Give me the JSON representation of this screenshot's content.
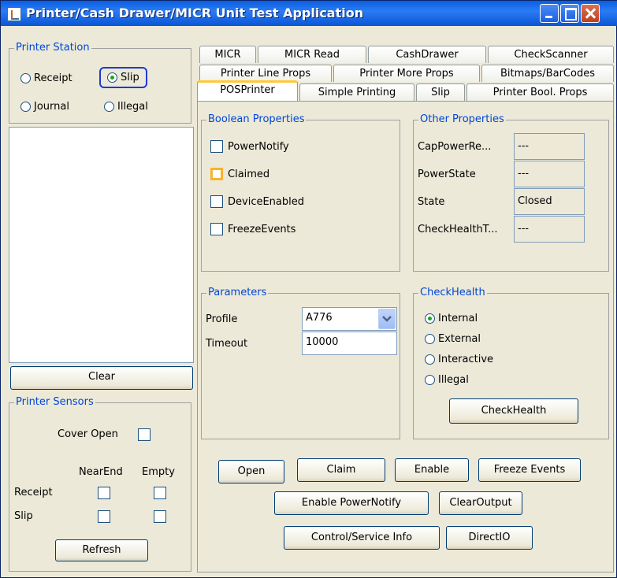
{
  "window": {
    "title": "Printer/Cash Drawer/MICR Unit Test Application"
  },
  "printer_station": {
    "legend": "Printer Station",
    "options": [
      {
        "label": "Receipt",
        "selected": false
      },
      {
        "label": "Slip",
        "selected": true
      },
      {
        "label": "Journal",
        "selected": false
      },
      {
        "label": "Illegal",
        "selected": false
      }
    ]
  },
  "clear_button": "Clear",
  "printer_sensors": {
    "legend": "Printer Sensors",
    "cover_open": "Cover Open",
    "near_end": "NearEnd",
    "empty": "Empty",
    "receipt": "Receipt",
    "slip": "Slip",
    "refresh": "Refresh"
  },
  "tabs": {
    "row1": [
      "MICR",
      "MICR Read",
      "CashDrawer",
      "CheckScanner"
    ],
    "row2": [
      "Printer Line Props",
      "Printer More Props",
      "Bitmaps/BarCodes"
    ],
    "row3": [
      "POSPrinter",
      "Simple Printing",
      "Slip",
      "Printer Bool. Props"
    ],
    "active": "POSPrinter"
  },
  "boolean_properties": {
    "legend": "Boolean Properties",
    "items": [
      {
        "label": "PowerNotify",
        "checked": false
      },
      {
        "label": "Claimed",
        "checked": false
      },
      {
        "label": "DeviceEnabled",
        "checked": false
      },
      {
        "label": "FreezeEvents",
        "checked": false
      }
    ]
  },
  "other_properties": {
    "legend": "Other Properties",
    "rows": [
      {
        "label": "CapPowerRe...",
        "value": "---"
      },
      {
        "label": "PowerState",
        "value": "---"
      },
      {
        "label": "State",
        "value": "Closed"
      },
      {
        "label": "CheckHealthT...",
        "value": "---"
      }
    ]
  },
  "parameters": {
    "legend": "Parameters",
    "profile_label": "Profile",
    "profile_value": "A776",
    "timeout_label": "Timeout",
    "timeout_value": "10000"
  },
  "check_health": {
    "legend": "CheckHealth",
    "options": [
      {
        "label": "Internal",
        "selected": true
      },
      {
        "label": "External",
        "selected": false
      },
      {
        "label": "Interactive",
        "selected": false
      },
      {
        "label": "Illegal",
        "selected": false
      }
    ],
    "button": "CheckHealth"
  },
  "actions": {
    "open": "Open",
    "claim": "Claim",
    "enable": "Enable",
    "freeze_events": "Freeze Events",
    "enable_power_notify": "Enable PowerNotify",
    "clear_output": "ClearOutput",
    "control_service_info": "Control/Service Info",
    "direct_io": "DirectIO"
  },
  "colors": {
    "legend_text": "#0046d5",
    "titlebar": "#0a5fe0",
    "window_bg": "#ece9d8",
    "tab_highlight": "#ffc83c"
  }
}
